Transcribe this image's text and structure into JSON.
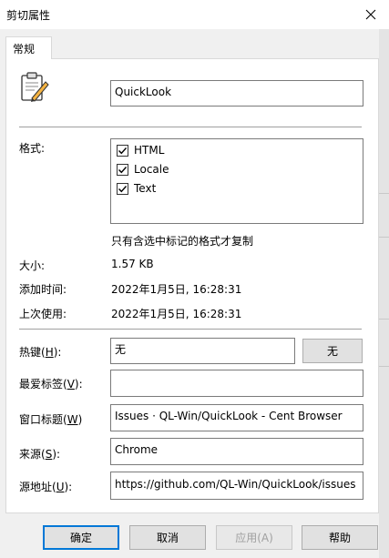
{
  "window": {
    "title": "剪切属性"
  },
  "tabs": [
    {
      "label": "常规"
    }
  ],
  "name_field": {
    "value": "QuickLook"
  },
  "formats": {
    "label": "格式:",
    "items": [
      {
        "label": "HTML",
        "checked": true
      },
      {
        "label": "Locale",
        "checked": true
      },
      {
        "label": "Text",
        "checked": true
      }
    ],
    "hint": "只有含选中标记的格式才复制"
  },
  "info": {
    "size_label": "大小:",
    "size_value": "1.57 KB",
    "added_label": "添加时间:",
    "added_value": "2022年1月5日, 16:28:31",
    "last_used_label": "上次使用:",
    "last_used_value": "2022年1月5日, 16:28:31"
  },
  "fields": {
    "hotkey": {
      "label_pre": "热键(",
      "mnemonic": "H",
      "label_post": "):",
      "value": "无",
      "button": "无"
    },
    "favorite": {
      "label_pre": "最爱标签(",
      "mnemonic": "V",
      "label_post": "):",
      "value": ""
    },
    "window_title": {
      "label_pre": "窗口标题(",
      "mnemonic": "W",
      "label_post": ")",
      "value": "Issues · QL-Win/QuickLook - Cent Browser"
    },
    "source": {
      "label_pre": "来源(",
      "mnemonic": "S",
      "label_post": "):",
      "value": "Chrome"
    },
    "source_url": {
      "label_pre": "源地址(",
      "mnemonic": "U",
      "label_post": "):",
      "value": "https://github.com/QL-Win/QuickLook/issues"
    }
  },
  "buttons": {
    "ok": "确定",
    "cancel": "取消",
    "apply": "应用(A)",
    "help": "帮助"
  }
}
